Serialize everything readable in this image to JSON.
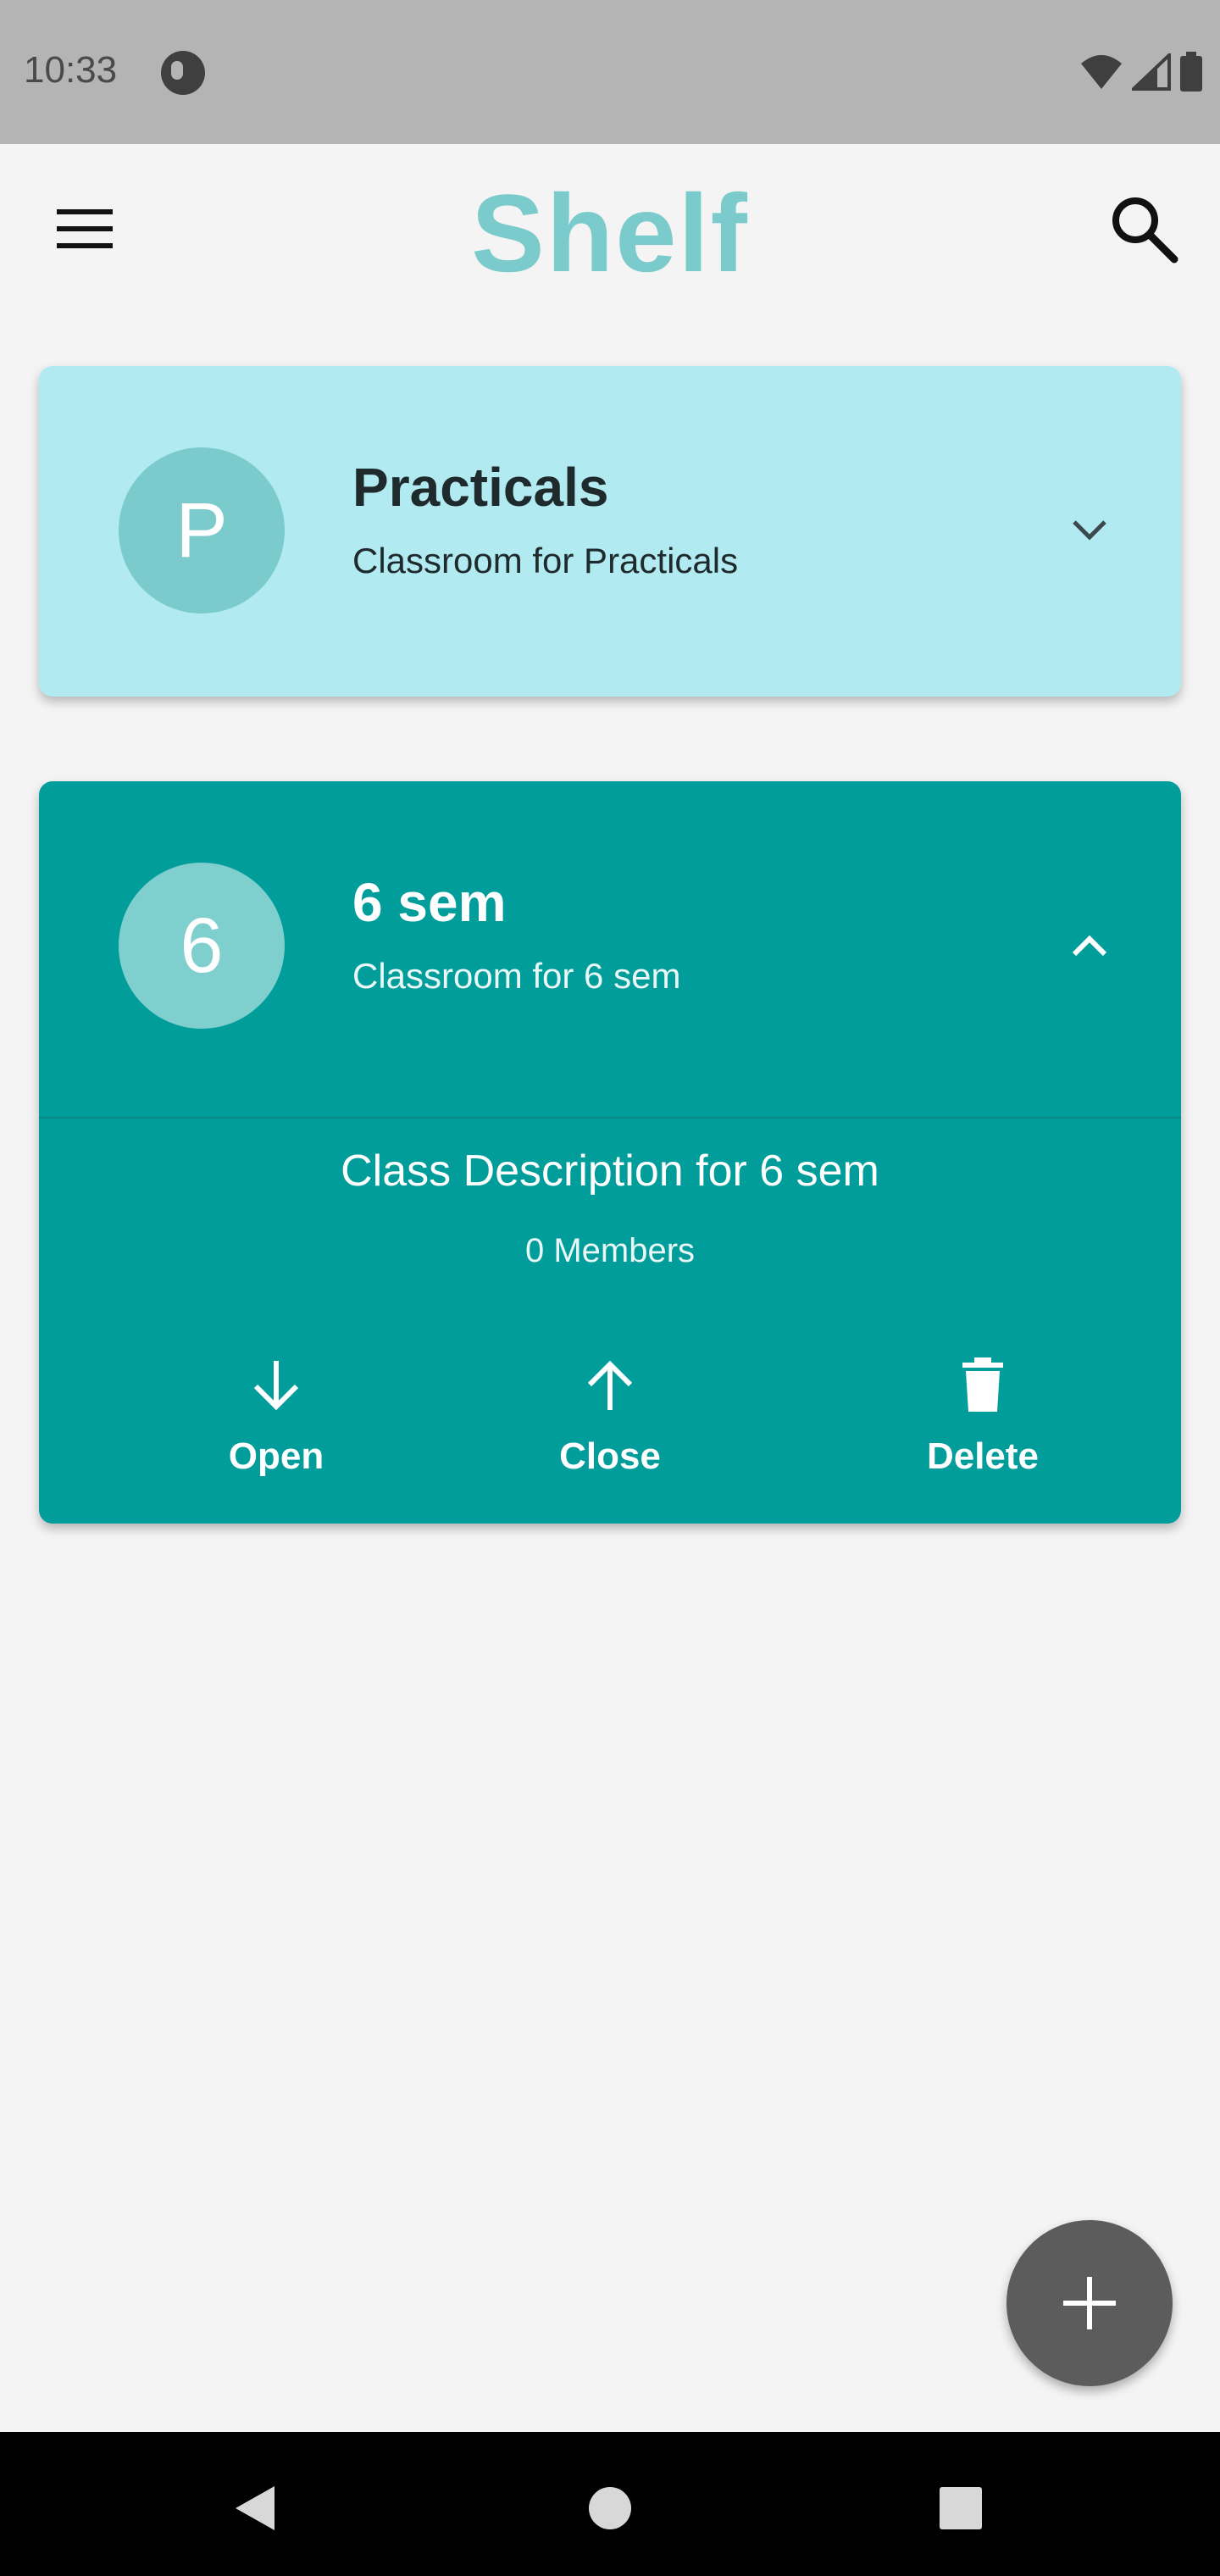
{
  "status_bar": {
    "time": "10:33",
    "icons": [
      "app-notification-icon",
      "wifi-icon",
      "signal-icon",
      "battery-icon"
    ]
  },
  "app_bar": {
    "title": "Shelf",
    "title_color": "#7ccbcc",
    "menu_icon": "hamburger-menu-icon",
    "search_icon": "search-icon"
  },
  "classes": [
    {
      "initial": "P",
      "name": "Practicals",
      "subtitle": "Classroom for Practicals",
      "expanded": false,
      "background": "#b1eaf1"
    },
    {
      "initial": "6",
      "name": "6 sem",
      "subtitle": "Classroom for 6 sem",
      "expanded": true,
      "background": "#009d9b",
      "description": "Class Description for 6 sem",
      "members": "0 Members",
      "actions": {
        "open": "Open",
        "close": "Close",
        "delete": "Delete"
      }
    }
  ],
  "fab": {
    "icon": "plus-icon",
    "color": "#5c5c5c"
  },
  "nav_bar": {
    "icons": [
      "back-icon",
      "home-icon",
      "recents-icon"
    ]
  }
}
